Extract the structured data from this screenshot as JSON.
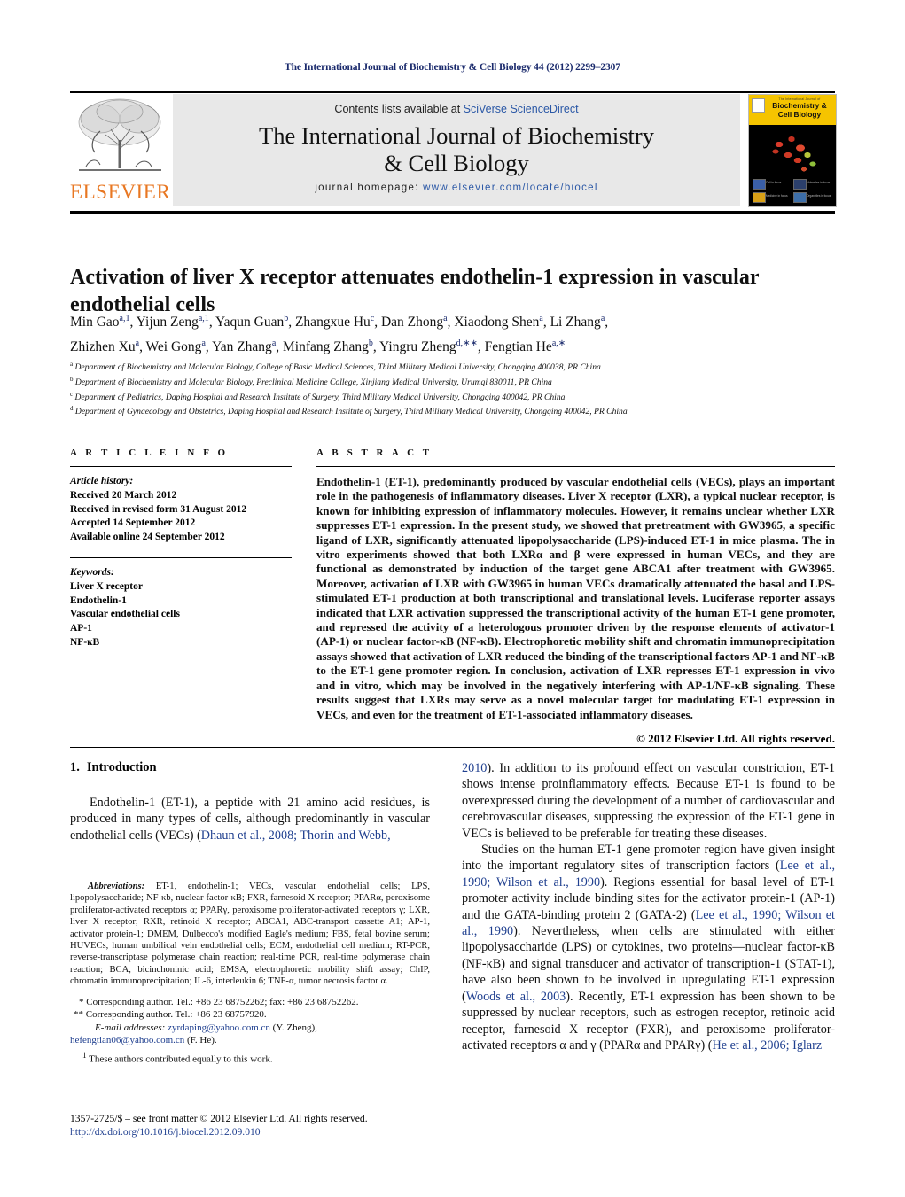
{
  "running_head": "The International Journal of Biochemistry & Cell Biology 44 (2012) 2299–2307",
  "masthead": {
    "contents_prefix": "Contents lists available at ",
    "sciencedirect": "SciVerse ScienceDirect",
    "journal_title_line1": "The International Journal of Biochemistry",
    "journal_title_line2": "& Cell Biology",
    "homepage_prefix": "journal homepage: ",
    "homepage_url": "www.elsevier.com/locate/biocel",
    "publisher_wordmark": "ELSEVIER",
    "cover": {
      "small_line": "The International Journal of",
      "title_line1": "Biochemistry &",
      "title_line2": "Cell Biology",
      "thumb_labels": [
        "Cell in focus",
        "Molecules in focus",
        "Medicine in focus",
        "Organelles in focus"
      ]
    }
  },
  "article": {
    "title": "Activation of liver X receptor attenuates endothelin-1 expression in vascular endothelial cells",
    "authors_line1": "Min Gao<sup>a,1</sup>, Yijun Zeng<sup>a,1</sup>, Yaqun Guan<sup>b</sup>, Zhangxue Hu<sup>c</sup>, Dan Zhong<sup>a</sup>, Xiaodong Shen<sup>a</sup>, Li Zhang<sup>a</sup>,",
    "authors_line2": "Zhizhen Xu<sup>a</sup>, Wei Gong<sup>a</sup>, Yan Zhang<sup>a</sup>, Minfang Zhang<sup>b</sup>, Yingru Zheng<sup>d,∗∗</sup>, Fengtian He<sup>a,∗</sup>",
    "affiliations": [
      "<sup>a</sup> Department of Biochemistry and Molecular Biology, College of Basic Medical Sciences, Third Military Medical University, Chongqing 400038, PR China",
      "<sup>b</sup> Department of Biochemistry and Molecular Biology, Preclinical Medicine College, Xinjiang Medical University, Urumqi 830011, PR China",
      "<sup>c</sup> Department of Pediatrics, Daping Hospital and Research Institute of Surgery, Third Military Medical University, Chongqing 400042, PR China",
      "<sup>d</sup> Department of Gynaecology and Obstetrics, Daping Hospital and Research Institute of Surgery, Third Military Medical University, Chongqing 400042, PR China"
    ]
  },
  "article_info": {
    "heading": "A R T I C L E   I N F O",
    "history_label": "Article history:",
    "history": [
      "Received 20 March 2012",
      "Received in revised form 31 August 2012",
      "Accepted 14 September 2012",
      "Available online 24 September 2012"
    ],
    "keywords_label": "Keywords:",
    "keywords": [
      "Liver X receptor",
      "Endothelin-1",
      "Vascular endothelial cells",
      "AP-1",
      "NF-κB"
    ]
  },
  "abstract": {
    "heading": "A B S T R A C T",
    "text": "Endothelin-1 (ET-1), predominantly produced by vascular endothelial cells (VECs), plays an important role in the pathogenesis of inflammatory diseases. Liver X receptor (LXR), a typical nuclear receptor, is known for inhibiting expression of inflammatory molecules. However, it remains unclear whether LXR suppresses ET-1 expression. In the present study, we showed that pretreatment with GW3965, a specific ligand of LXR, significantly attenuated lipopolysaccharide (LPS)-induced ET-1 in mice plasma. The in vitro experiments showed that both LXRα and β were expressed in human VECs, and they are functional as demonstrated by induction of the target gene ABCA1 after treatment with GW3965. Moreover, activation of LXR with GW3965 in human VECs dramatically attenuated the basal and LPS-stimulated ET-1 production at both transcriptional and translational levels. Luciferase reporter assays indicated that LXR activation suppressed the transcriptional activity of the human ET-1 gene promoter, and repressed the activity of a heterologous promoter driven by the response elements of activator-1 (AP-1) or nuclear factor-κB (NF-κB). Electrophoretic mobility shift and chromatin immunoprecipitation assays showed that activation of LXR reduced the binding of the transcriptional factors AP-1 and NF-κB to the ET-1 gene promoter region. In conclusion, activation of LXR represses ET-1 expression in vivo and in vitro, which may be involved in the negatively interfering with AP-1/NF-κB signaling. These results suggest that LXRs may serve as a novel molecular target for modulating ET-1 expression in VECs, and even for the treatment of ET-1-associated inflammatory diseases.",
    "copyright": "© 2012 Elsevier Ltd. All rights reserved."
  },
  "introduction": {
    "number": "1.",
    "heading": "Introduction",
    "left_para1": "Endothelin-1 (ET-1), a peptide with 21 amino acid residues, is produced in many types of cells, although predominantly in vascular endothelial cells (VECs) (<span class=\"cite\">Dhaun et al., 2008; Thorin and Webb,</span>",
    "right_para1": "<span class=\"cite\">2010</span>). In addition to its profound effect on vascular constriction, ET-1 shows intense proinflammatory effects. Because ET-1 is found to be overexpressed during the development of a number of cardiovascular and cerebrovascular diseases, suppressing the expression of the ET-1 gene in VECs is believed to be preferable for treating these diseases.",
    "right_para2": "Studies on the human ET-1 gene promoter region have given insight into the important regulatory sites of transcription factors (<span class=\"cite\">Lee et al., 1990; Wilson et al., 1990</span>). Regions essential for basal level of ET-1 promoter activity include binding sites for the activator protein-1 (AP-1) and the GATA-binding protein 2 (GATA-2) (<span class=\"cite\">Lee et al., 1990; Wilson et al., 1990</span>). Nevertheless, when cells are stimulated with either lipopolysaccharide (LPS) or cytokines, two proteins—nuclear factor-κB (NF-κB) and signal transducer and activator of transcription-1 (STAT-1), have also been shown to be involved in upregulating ET-1 expression (<span class=\"cite\">Woods et al., 2003</span>). Recently, ET-1 expression has been shown to be suppressed by nuclear receptors, such as estrogen receptor, retinoic acid receptor, farnesoid X receptor (FXR), and peroxisome proliferator-activated receptors α and γ (PPARα and PPARγ) (<span class=\"cite\">He et al., 2006; Iglarz</span>"
  },
  "footnotes": {
    "abbreviations_label": "Abbreviations:",
    "abbreviations": "ET-1, endothelin-1; VECs, vascular endothelial cells; LPS, lipopolysaccharide; NF-κb, nuclear factor-κB; FXR, farnesoid X receptor; PPARα, peroxisome proliferator-activated receptors α; PPARγ, peroxisome proliferator-activated receptors γ; LXR, liver X receptor; RXR, retinoid X receptor; ABCA1, ABC-transport cassette A1; AP-1, activator protein-1; DMEM, Dulbecco's modified Eagle's medium; FBS, fetal bovine serum; HUVECs, human umbilical vein endothelial cells; ECM, endothelial cell medium; RT-PCR, reverse-transcriptase polymerase chain reaction; real-time PCR, real-time polymerase chain reaction; BCA, bicinchoninic acid; EMSA, electrophoretic mobility shift assay; ChIP, chromatin immunoprecipitation; IL-6, interleukin 6; TNF-α, tumor necrosis factor α.",
    "corresponding1": "* Corresponding author. Tel.: +86 23 68752262; fax: +86 23 68752262.",
    "corresponding2": "** Corresponding author. Tel.: +86 23 68757920.",
    "email_label": "E-mail addresses:",
    "email1": "zyrdaping@yahoo.com.cn",
    "email1_owner": "(Y. Zheng),",
    "email2": "hefengtian06@yahoo.com.cn",
    "email2_owner": "(F. He).",
    "equal_contrib": "These authors contributed equally to this work.",
    "equal_marker": "1"
  },
  "colophon": {
    "issn_line": "1357-2725/$ – see front matter © 2012 Elsevier Ltd. All rights reserved.",
    "doi": "http://dx.doi.org/10.1016/j.biocel.2012.09.010"
  },
  "colors": {
    "link_blue": "#1f3f8f",
    "header_blue": "#1a2a6c",
    "elsevier_orange": "#e87722",
    "cover_yellow": "#f5c400",
    "band_gray": "#e8e8e8"
  }
}
